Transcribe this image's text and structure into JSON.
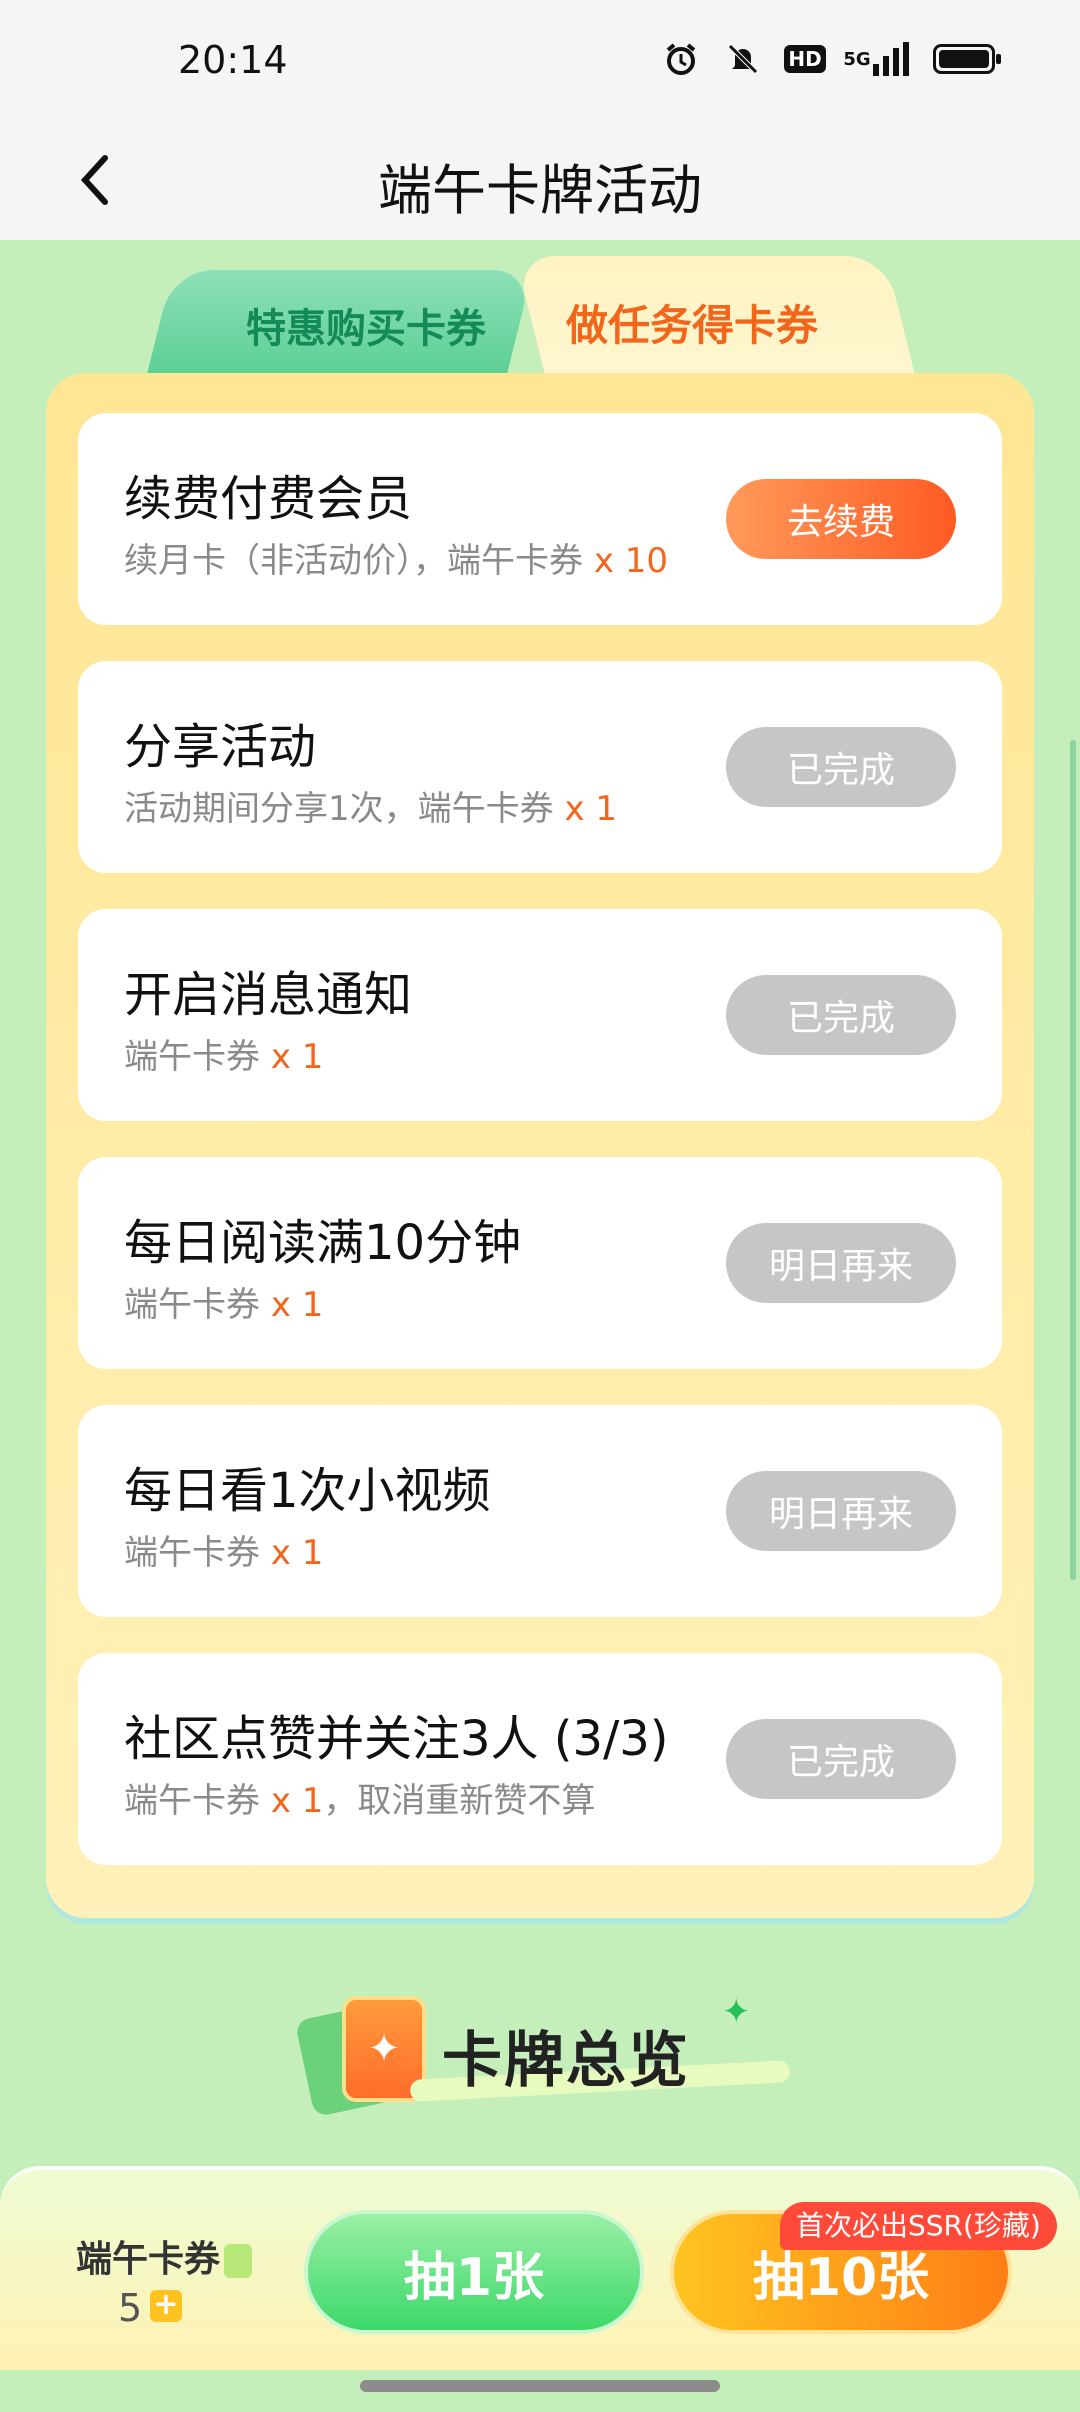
{
  "status_bar": {
    "time": "20:14",
    "network": "5G",
    "hd": "HD"
  },
  "header": {
    "title": "端午卡牌活动"
  },
  "tabs": [
    {
      "label": "特惠购买卡券",
      "active": false
    },
    {
      "label": "做任务得卡券",
      "active": true
    }
  ],
  "tasks": [
    {
      "title": "续费付费会员",
      "desc_prefix": "续月卡（非活动价），端午卡券 ",
      "qty": "x 10",
      "desc_suffix": "",
      "button": "去续费",
      "state": "active"
    },
    {
      "title": "分享活动",
      "desc_prefix": "活动期间分享1次，端午卡券 ",
      "qty": "x 1",
      "desc_suffix": "",
      "button": "已完成",
      "state": "done"
    },
    {
      "title": "开启消息通知",
      "desc_prefix": "端午卡券 ",
      "qty": "x 1",
      "desc_suffix": "",
      "button": "已完成",
      "state": "done"
    },
    {
      "title": "每日阅读满10分钟",
      "desc_prefix": "端午卡券 ",
      "qty": "x 1",
      "desc_suffix": "",
      "button": "明日再来",
      "state": "later"
    },
    {
      "title": "每日看1次小视频",
      "desc_prefix": "端午卡券 ",
      "qty": "x 1",
      "desc_suffix": "",
      "button": "明日再来",
      "state": "later"
    },
    {
      "title": "社区点赞并关注3人 (3/3)",
      "desc_prefix": "端午卡券 ",
      "qty": "x 1",
      "desc_suffix": "，取消重新赞不算",
      "button": "已完成",
      "state": "done"
    }
  ],
  "overview": {
    "label": "卡牌总览"
  },
  "bottom": {
    "coupon_label": "端午卡券",
    "coupon_count": "5",
    "draw_one": "抽1张",
    "draw_ten": "抽10张",
    "ssr_badge": "首次必出SSR(珍藏)"
  },
  "colors": {
    "accent_orange": "#f2661c",
    "disabled_gray": "#c6c6c6",
    "page_green": "#c4efbb"
  }
}
